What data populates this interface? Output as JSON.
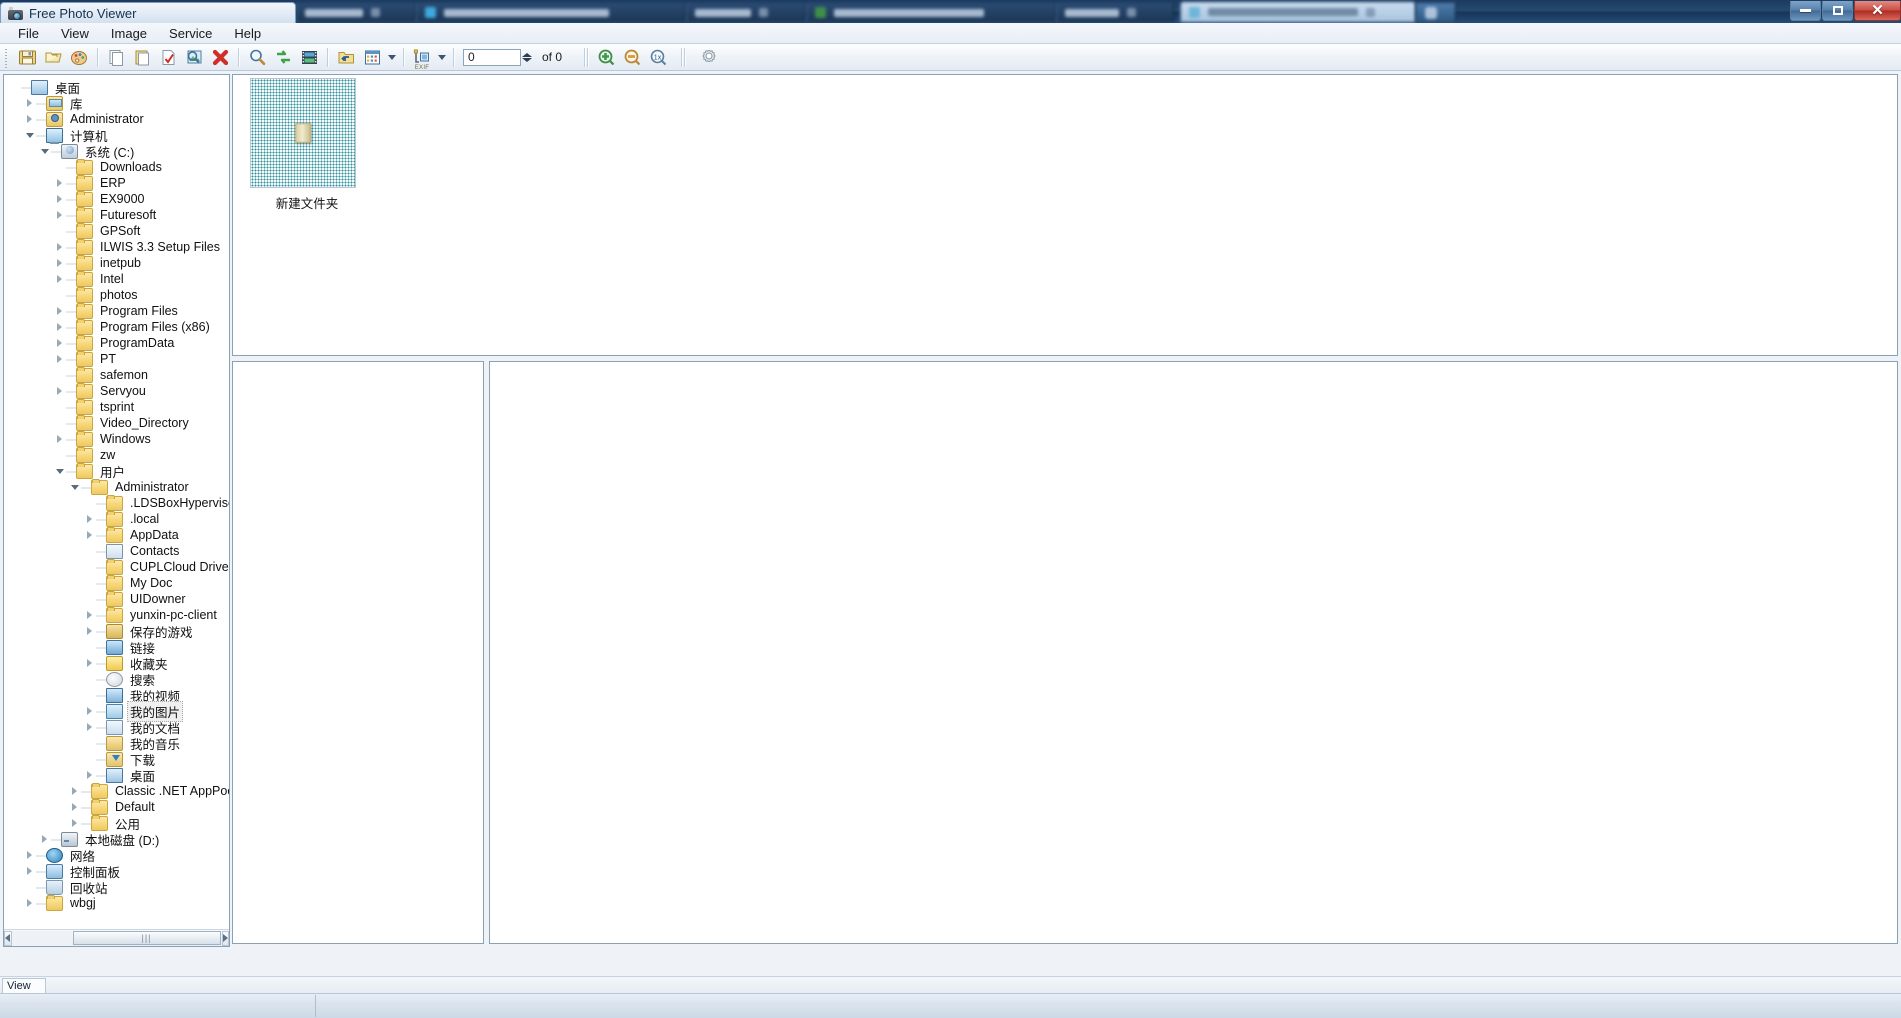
{
  "window": {
    "app_title": "Free Photo Viewer",
    "app_icon": "camera-icon",
    "controls": {
      "minimize": "minimize-icon",
      "maximize": "maximize-icon",
      "close": "close-icon"
    }
  },
  "menubar": {
    "items": [
      {
        "label": "File"
      },
      {
        "label": "View"
      },
      {
        "label": "Image"
      },
      {
        "label": "Service"
      },
      {
        "label": "Help"
      }
    ]
  },
  "toolbar": {
    "buttons": [
      {
        "name": "save-icon"
      },
      {
        "name": "open-folder-icon"
      },
      {
        "name": "edit-palette-icon"
      },
      {
        "name": "copy-icon"
      },
      {
        "name": "paste-icon"
      },
      {
        "name": "check-file-icon"
      },
      {
        "name": "image-search-icon"
      },
      {
        "name": "delete-icon"
      },
      {
        "name": "magnifier-icon"
      },
      {
        "name": "refresh-icon"
      },
      {
        "name": "filmstrip-icon"
      },
      {
        "name": "up-folder-icon"
      },
      {
        "name": "view-mode-icon"
      },
      {
        "name": "exif-icon"
      },
      {
        "name": "zoom-in-icon"
      },
      {
        "name": "zoom-out-icon"
      },
      {
        "name": "zoom-actual-icon"
      },
      {
        "name": "settings-gear-icon"
      }
    ],
    "exif_caption": "EXIF",
    "page_value": "0",
    "page_placeholder": "0",
    "page_total": "of 0"
  },
  "tree": {
    "nodes": [
      {
        "label": "桌面",
        "depth": 0,
        "expander": "none",
        "icon": "desk",
        "selected": false
      },
      {
        "label": "库",
        "depth": 1,
        "expander": "closed",
        "icon": "lib",
        "selected": false
      },
      {
        "label": "Administrator",
        "depth": 1,
        "expander": "closed",
        "icon": "user",
        "selected": false
      },
      {
        "label": "计算机",
        "depth": 1,
        "expander": "open",
        "icon": "monitor",
        "selected": false
      },
      {
        "label": "系统 (C:)",
        "depth": 2,
        "expander": "open",
        "icon": "drivegear",
        "selected": false
      },
      {
        "label": "Downloads",
        "depth": 3,
        "expander": "none",
        "icon": "folder",
        "selected": false
      },
      {
        "label": "ERP",
        "depth": 3,
        "expander": "closed",
        "icon": "folder",
        "selected": false
      },
      {
        "label": "EX9000",
        "depth": 3,
        "expander": "closed",
        "icon": "folder",
        "selected": false
      },
      {
        "label": "Futuresoft",
        "depth": 3,
        "expander": "closed",
        "icon": "folder",
        "selected": false
      },
      {
        "label": "GPSoft",
        "depth": 3,
        "expander": "none",
        "icon": "folder",
        "selected": false
      },
      {
        "label": "ILWIS 3.3 Setup Files",
        "depth": 3,
        "expander": "closed",
        "icon": "folder",
        "selected": false
      },
      {
        "label": "inetpub",
        "depth": 3,
        "expander": "closed",
        "icon": "folder",
        "selected": false
      },
      {
        "label": "Intel",
        "depth": 3,
        "expander": "closed",
        "icon": "folder",
        "selected": false
      },
      {
        "label": "photos",
        "depth": 3,
        "expander": "none",
        "icon": "folder",
        "selected": false
      },
      {
        "label": "Program Files",
        "depth": 3,
        "expander": "closed",
        "icon": "folder",
        "selected": false
      },
      {
        "label": "Program Files (x86)",
        "depth": 3,
        "expander": "closed",
        "icon": "folder",
        "selected": false
      },
      {
        "label": "ProgramData",
        "depth": 3,
        "expander": "closed",
        "icon": "folder",
        "selected": false
      },
      {
        "label": "PT",
        "depth": 3,
        "expander": "closed",
        "icon": "folder",
        "selected": false
      },
      {
        "label": "safemon",
        "depth": 3,
        "expander": "none",
        "icon": "folder",
        "selected": false
      },
      {
        "label": "Servyou",
        "depth": 3,
        "expander": "closed",
        "icon": "folder",
        "selected": false
      },
      {
        "label": "tsprint",
        "depth": 3,
        "expander": "none",
        "icon": "folder",
        "selected": false
      },
      {
        "label": "Video_Directory",
        "depth": 3,
        "expander": "none",
        "icon": "folder",
        "selected": false
      },
      {
        "label": "Windows",
        "depth": 3,
        "expander": "closed",
        "icon": "folder",
        "selected": false
      },
      {
        "label": "zw",
        "depth": 3,
        "expander": "none",
        "icon": "folder",
        "selected": false
      },
      {
        "label": "用户",
        "depth": 3,
        "expander": "open",
        "icon": "folder",
        "selected": false
      },
      {
        "label": "Administrator",
        "depth": 4,
        "expander": "open",
        "icon": "folder",
        "selected": false
      },
      {
        "label": ".LDSBoxHypervisorGl",
        "depth": 5,
        "expander": "none",
        "icon": "folder",
        "selected": false
      },
      {
        "label": ".local",
        "depth": 5,
        "expander": "closed",
        "icon": "folder",
        "selected": false
      },
      {
        "label": "AppData",
        "depth": 5,
        "expander": "closed",
        "icon": "folder",
        "selected": false
      },
      {
        "label": "Contacts",
        "depth": 5,
        "expander": "none",
        "icon": "contact",
        "selected": false
      },
      {
        "label": "CUPLCloud Drive",
        "depth": 5,
        "expander": "none",
        "icon": "folder",
        "selected": false
      },
      {
        "label": "My Doc",
        "depth": 5,
        "expander": "none",
        "icon": "folder",
        "selected": false
      },
      {
        "label": "UIDowner",
        "depth": 5,
        "expander": "none",
        "icon": "folder",
        "selected": false
      },
      {
        "label": "yunxin-pc-client",
        "depth": 5,
        "expander": "closed",
        "icon": "folder",
        "selected": false
      },
      {
        "label": "保存的游戏",
        "depth": 5,
        "expander": "closed",
        "icon": "game",
        "selected": false
      },
      {
        "label": "链接",
        "depth": 5,
        "expander": "none",
        "icon": "link",
        "selected": false
      },
      {
        "label": "收藏夹",
        "depth": 5,
        "expander": "closed",
        "icon": "star",
        "selected": false
      },
      {
        "label": "搜索",
        "depth": 5,
        "expander": "none",
        "icon": "search",
        "selected": false
      },
      {
        "label": "我的视频",
        "depth": 5,
        "expander": "none",
        "icon": "video",
        "selected": false
      },
      {
        "label": "我的图片",
        "depth": 5,
        "expander": "closed",
        "icon": "pics",
        "selected": true
      },
      {
        "label": "我的文档",
        "depth": 5,
        "expander": "closed",
        "icon": "docs",
        "selected": false
      },
      {
        "label": "我的音乐",
        "depth": 5,
        "expander": "none",
        "icon": "music",
        "selected": false
      },
      {
        "label": "下载",
        "depth": 5,
        "expander": "none",
        "icon": "dl",
        "selected": false
      },
      {
        "label": "桌面",
        "depth": 5,
        "expander": "closed",
        "icon": "desk",
        "selected": false
      },
      {
        "label": "Classic .NET AppPool",
        "depth": 4,
        "expander": "closed",
        "icon": "folder",
        "selected": false
      },
      {
        "label": "Default",
        "depth": 4,
        "expander": "closed",
        "icon": "folder",
        "selected": false
      },
      {
        "label": "公用",
        "depth": 4,
        "expander": "closed",
        "icon": "folder",
        "selected": false
      },
      {
        "label": "本地磁盘 (D:)",
        "depth": 2,
        "expander": "closed",
        "icon": "drive",
        "selected": false
      },
      {
        "label": "网络",
        "depth": 1,
        "expander": "closed",
        "icon": "net",
        "selected": false
      },
      {
        "label": "控制面板",
        "depth": 1,
        "expander": "closed",
        "icon": "cpl",
        "selected": false
      },
      {
        "label": "回收站",
        "depth": 1,
        "expander": "none",
        "icon": "bin",
        "selected": false
      },
      {
        "label": "wbgj",
        "depth": 1,
        "expander": "closed",
        "icon": "folder",
        "selected": false
      }
    ],
    "hscroll": {
      "left": "scroll-left-arrow",
      "right": "scroll-right-arrow",
      "thumb": "|||"
    }
  },
  "thumbnails": {
    "items": [
      {
        "label": "新建文件夹",
        "icon": "folder-thumbnail"
      }
    ]
  },
  "statusbar": {
    "cells": [
      {
        "text": "View"
      }
    ]
  }
}
